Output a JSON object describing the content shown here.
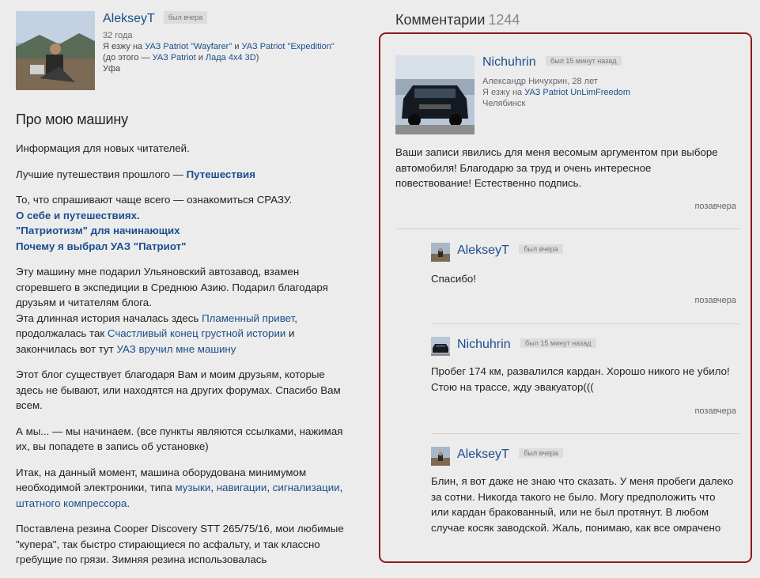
{
  "author": {
    "name": "AlekseyT",
    "status": "был вчера",
    "age": "32 года",
    "rides_prefix": "Я езжу на ",
    "car1": "УАЗ Patriot \"Wayfarer\"",
    "and": " и ",
    "car2": "УАЗ Patriot \"Expedition\"",
    "before_prefix": "(до этого — ",
    "prev1": "УАЗ Patriot",
    "and2": " и ",
    "prev2": "Лада 4x4 3D",
    "before_suffix": ")",
    "city": "Уфа"
  },
  "about": {
    "title": "Про мою машину",
    "p1": "Информация для новых читателей.",
    "p2_text": "Лучшие путешествия прошлого — ",
    "p2_link": "Путешествия",
    "p3_text": "То, что спрашивают чаще всего — ознакомиться СРАЗУ.",
    "p3_link1": "О себе и путешествиях.",
    "p3_link2": "\"Патриотизм\" для начинающих",
    "p3_link3": "Почему я выбрал УАЗ \"Патриот\"",
    "p4_text1": "Эту машину мне подарил Ульяновский автозавод, взамен сгоревшего в экспедиции в Среднюю Азию. Подарил благодаря друзьям и читателям блога.",
    "p4_text2": "Эта длинная история началась здесь ",
    "p4_link1": "Пламенный привет",
    "p4_text3": ", продолжалась так ",
    "p4_link2": "Счастливый конец грустной истории",
    "p4_text4": " и закончилась вот тут ",
    "p4_link3": "УАЗ вручил мне машину",
    "p5": "Этот блог существует благодаря Вам и моим друзьям, которые здесь не бывают, или находятся на других форумах. Спасибо Вам всем.",
    "p6": "А мы... — мы начинаем. (все пункты являются ссылками, нажимая их, вы попадете в запись об установке)",
    "p7_text1": "Итак, на данный момент, машина оборудована минимумом необходимой электроники, типа ",
    "p7_link1": "музыки",
    "p7_sep1": ", ",
    "p7_link2": "навигации",
    "p7_sep2": ", ",
    "p7_link3": "сигнализации",
    "p7_sep3": ", ",
    "p7_link4": "штатного компрессора",
    "p7_end": ".",
    "p8": "Поставлена резина Cooper Discovery STT 265/75/16, мои любимые \"купера\", так быстро стирающиеся по асфальту, и так классно гребущие по грязи. Зимняя резина использовалась"
  },
  "comments": {
    "title": "Комментарии",
    "count": "1244",
    "items": [
      {
        "name": "Nichuhrin",
        "status": "был 15 минут назад",
        "fullname": "Александр Ничухрин, 28 лет",
        "rides_prefix": "Я езжу на ",
        "car": "УАЗ Patriot UnLimFreedom",
        "city": "Челябинск",
        "text": "Ваши записи явились для меня весомым аргументом при выборе автомобиля! Благодарю за труд и очень интересное повествование! Естественно подпись.",
        "date": "позавчера"
      },
      {
        "name": "AlekseyT",
        "status": "был вчера",
        "text": "Спасибо!",
        "date": "позавчера"
      },
      {
        "name": "Nichuhrin",
        "status": "был 15 минут назад",
        "text": "Пробег 174 км, развалился кардан. Хорошо никого не убило! Стою на трассе, жду эвакуатор(((",
        "date": "позавчера"
      },
      {
        "name": "AlekseyT",
        "status": "был вчера",
        "text": "Блин, я вот даже не знаю что сказать. У меня пробеги далеко за сотни. Никогда такого не было. Могу предположить что или кардан бракованный, или не был протянут. В любом случае косяк заводской. Жаль, понимаю, как все омрачено"
      }
    ]
  }
}
